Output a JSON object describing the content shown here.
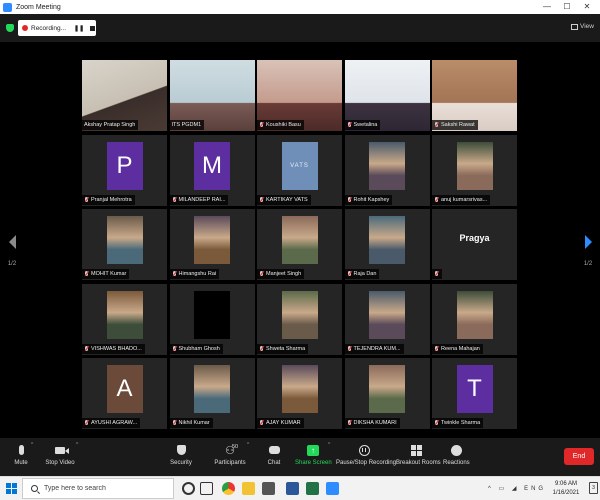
{
  "window": {
    "title": "Zoom Meeting",
    "controls": [
      "—",
      "☐",
      "✕"
    ]
  },
  "meeting": {
    "recording_label": "Recording...",
    "view_label": "View"
  },
  "pagination": {
    "left": "1/2",
    "right": "1/2"
  },
  "participants": [
    {
      "name": "Akshay Pratap Singh",
      "muted": false,
      "active": true,
      "kind": "video"
    },
    {
      "name": "ITS PGDM1",
      "muted": false,
      "kind": "video"
    },
    {
      "name": "Koushiki Basu",
      "muted": true,
      "kind": "video"
    },
    {
      "name": "Swetalina",
      "muted": true,
      "kind": "video"
    },
    {
      "name": "Sakshi Rawat",
      "muted": true,
      "kind": "video"
    },
    {
      "name": "Pranjal Mehrotra",
      "muted": true,
      "kind": "avatar",
      "initial": "P",
      "avatar_color": "#5c2ea0"
    },
    {
      "name": "MILANDEEP RAI...",
      "muted": true,
      "kind": "avatar",
      "initial": "M",
      "avatar_color": "#5c2ea0"
    },
    {
      "name": "KARTIKAY VATS",
      "muted": true,
      "kind": "avatar-text",
      "avatar_text": "VATS"
    },
    {
      "name": "Rohit Kapshey",
      "muted": true,
      "kind": "photo"
    },
    {
      "name": "anuj kumarsrivas...",
      "muted": true,
      "kind": "photo"
    },
    {
      "name": "MOHIT Kumar",
      "muted": true,
      "kind": "photo"
    },
    {
      "name": "Himangshu Rai",
      "muted": true,
      "kind": "photo"
    },
    {
      "name": "Manjeet Singh",
      "muted": true,
      "kind": "photo"
    },
    {
      "name": "Raja Dan",
      "muted": true,
      "kind": "photo"
    },
    {
      "name": "",
      "muted": true,
      "kind": "name-only",
      "display_name": "Pragya"
    },
    {
      "name": "VISHWAS BHADO...",
      "muted": true,
      "kind": "photo"
    },
    {
      "name": "Shubham Ghosh",
      "muted": true,
      "kind": "black"
    },
    {
      "name": "Shweta Sharma",
      "muted": true,
      "kind": "photo"
    },
    {
      "name": "TEJENDRA KUM...",
      "muted": true,
      "kind": "photo"
    },
    {
      "name": "Reena Mahajan",
      "muted": true,
      "kind": "photo"
    },
    {
      "name": "AYUSHI AGRAW...",
      "muted": true,
      "kind": "avatar",
      "initial": "A",
      "avatar_color": "#6b4a3a"
    },
    {
      "name": "Nikhil Kumar",
      "muted": true,
      "kind": "photo"
    },
    {
      "name": "AJAY KUMAR",
      "muted": true,
      "kind": "photo"
    },
    {
      "name": "DIKSHA KUMARI",
      "muted": true,
      "kind": "photo"
    },
    {
      "name": "Twinkle Sharma",
      "muted": true,
      "kind": "avatar",
      "initial": "T",
      "avatar_color": "#5c2ea0"
    }
  ],
  "toolbar": {
    "mute": "Mute",
    "stop_video": "Stop Video",
    "security": "Security",
    "participants": "Participants",
    "participants_count": "50",
    "chat": "Chat",
    "share_screen": "Share Screen",
    "pause_stop_recording": "Pause/Stop Recording",
    "breakout_rooms": "Breakout Rooms",
    "reactions": "Reactions",
    "end": "End"
  },
  "taskbar": {
    "search_placeholder": "Type here to search",
    "time": "9:06 AM",
    "date": "1/16/2021",
    "notification_count": "3",
    "tray": "^ ▭ ◢ ENG"
  },
  "colors": {
    "accent": "#2d8cff",
    "end_button": "#e02828",
    "share_green": "#23d959",
    "active_speaker": "#c4d65b"
  }
}
